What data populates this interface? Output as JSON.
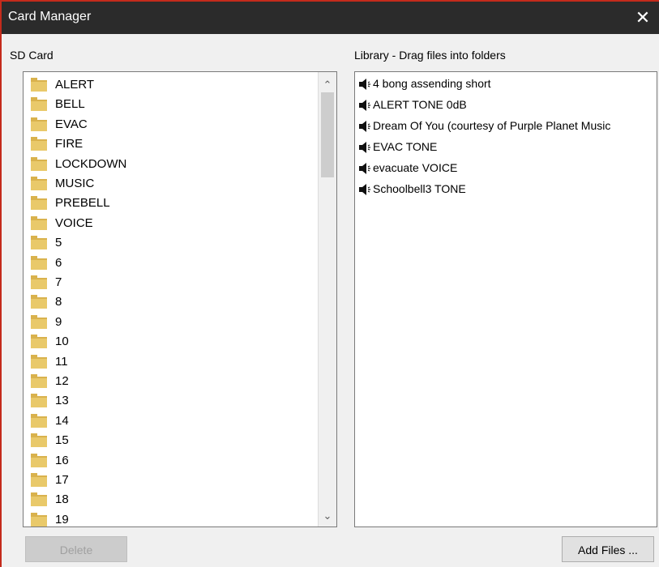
{
  "window": {
    "title": "Card Manager",
    "close_glyph": "✕"
  },
  "sd_card": {
    "label": "SD Card",
    "items": [
      "ALERT",
      "BELL",
      "EVAC",
      "FIRE",
      "LOCKDOWN",
      "MUSIC",
      "PREBELL",
      "VOICE",
      "5",
      "6",
      "7",
      "8",
      "9",
      "10",
      "11",
      "12",
      "13",
      "14",
      "15",
      "16",
      "17",
      "18",
      "19"
    ],
    "scroll_up": "⌃",
    "scroll_down": "⌄"
  },
  "library": {
    "label": "Library - Drag files into folders",
    "items": [
      "4 bong assending short",
      "ALERT TONE 0dB",
      "Dream Of You (courtesy of Purple Planet Music",
      "EVAC TONE",
      "evacuate VOICE",
      "Schoolbell3 TONE"
    ]
  },
  "buttons": {
    "delete": "Delete",
    "add_files": "Add Files ..."
  },
  "colors": {
    "title_bar": "#2b2b2b",
    "window_border": "#c42b1c",
    "folder": "#e9c96a"
  },
  "icons": {
    "folder": "folder-icon",
    "speaker": "speaker-icon",
    "close": "close-icon"
  }
}
